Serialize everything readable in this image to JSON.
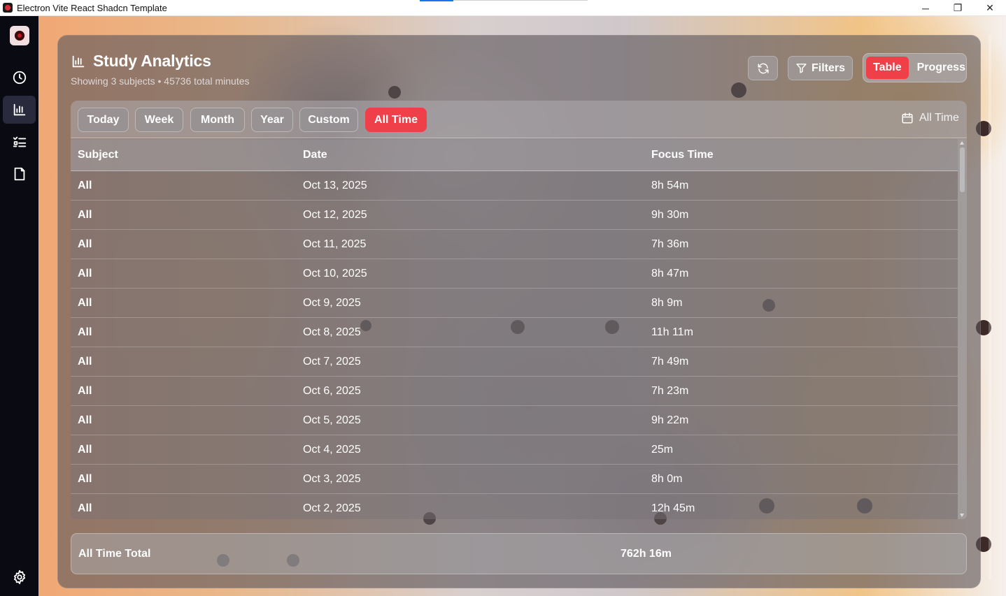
{
  "window": {
    "title": "Electron Vite React Shadcn Template",
    "controls": {
      "minimize": "─",
      "maximize": "❐",
      "close": "✕"
    }
  },
  "sidebar": {
    "items": [
      {
        "name": "clock",
        "icon": "clock-icon"
      },
      {
        "name": "analytics",
        "icon": "bar-chart-icon",
        "active": true
      },
      {
        "name": "tasks",
        "icon": "list-checks-icon"
      },
      {
        "name": "notes",
        "icon": "file-icon"
      }
    ],
    "settings_icon": "gear-icon"
  },
  "header": {
    "title": "Study Analytics",
    "subtitle": "Showing 3 subjects • 45736 total minutes",
    "filters_label": "Filters",
    "view_toggle": {
      "table": "Table",
      "progress": "Progress",
      "active": "Table"
    }
  },
  "range": {
    "tabs": [
      "Today",
      "Week",
      "Month",
      "Year",
      "Custom",
      "All Time"
    ],
    "active": "All Time",
    "current_label": "All Time"
  },
  "table": {
    "columns": [
      "Subject",
      "Date",
      "Focus Time"
    ],
    "rows": [
      {
        "subject": "All",
        "date": "Oct 13, 2025",
        "focus": "8h 54m"
      },
      {
        "subject": "All",
        "date": "Oct 12, 2025",
        "focus": "9h 30m"
      },
      {
        "subject": "All",
        "date": "Oct 11, 2025",
        "focus": "7h 36m"
      },
      {
        "subject": "All",
        "date": "Oct 10, 2025",
        "focus": "8h 47m"
      },
      {
        "subject": "All",
        "date": "Oct 9, 2025",
        "focus": "8h 9m"
      },
      {
        "subject": "All",
        "date": "Oct 8, 2025",
        "focus": "11h 11m"
      },
      {
        "subject": "All",
        "date": "Oct 7, 2025",
        "focus": "7h 49m"
      },
      {
        "subject": "All",
        "date": "Oct 6, 2025",
        "focus": "7h 23m"
      },
      {
        "subject": "All",
        "date": "Oct 5, 2025",
        "focus": "9h 22m"
      },
      {
        "subject": "All",
        "date": "Oct 4, 2025",
        "focus": "25m"
      },
      {
        "subject": "All",
        "date": "Oct 3, 2025",
        "focus": "8h 0m"
      },
      {
        "subject": "All",
        "date": "Oct 2, 2025",
        "focus": "12h 45m"
      }
    ]
  },
  "total": {
    "label": "All Time Total",
    "value": "762h 16m"
  },
  "colors": {
    "accent": "#ef3f49",
    "sidebar": "#0a0a12",
    "panel": "#5c565a"
  }
}
